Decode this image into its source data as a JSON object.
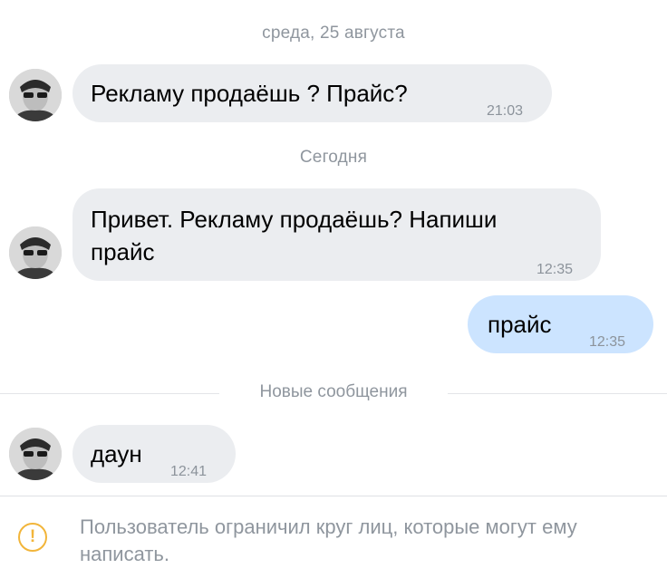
{
  "date_separators": [
    "среда, 25 августа",
    "Сегодня"
  ],
  "messages": [
    {
      "direction": "incoming",
      "text": "Рекламу продаёшь ? Прайс?",
      "time": "21:03"
    },
    {
      "direction": "incoming",
      "line1": "Привет. Рекламу продаёшь? Напиши",
      "line2": "прайс",
      "time": "12:35"
    },
    {
      "direction": "outgoing",
      "text": "прайс",
      "time": "12:35"
    },
    {
      "direction": "incoming",
      "text": "даун",
      "time": "12:41"
    }
  ],
  "new_messages_label": "Новые сообщения",
  "notice": {
    "icon": "exclamation-circle-icon",
    "text": "Пользователь ограничил круг лиц, которые могут ему написать."
  },
  "colors": {
    "incoming_bubble": "#ebedf0",
    "outgoing_bubble": "#cce4ff",
    "meta_text": "#8f969e",
    "warning": "#f2b53a"
  }
}
